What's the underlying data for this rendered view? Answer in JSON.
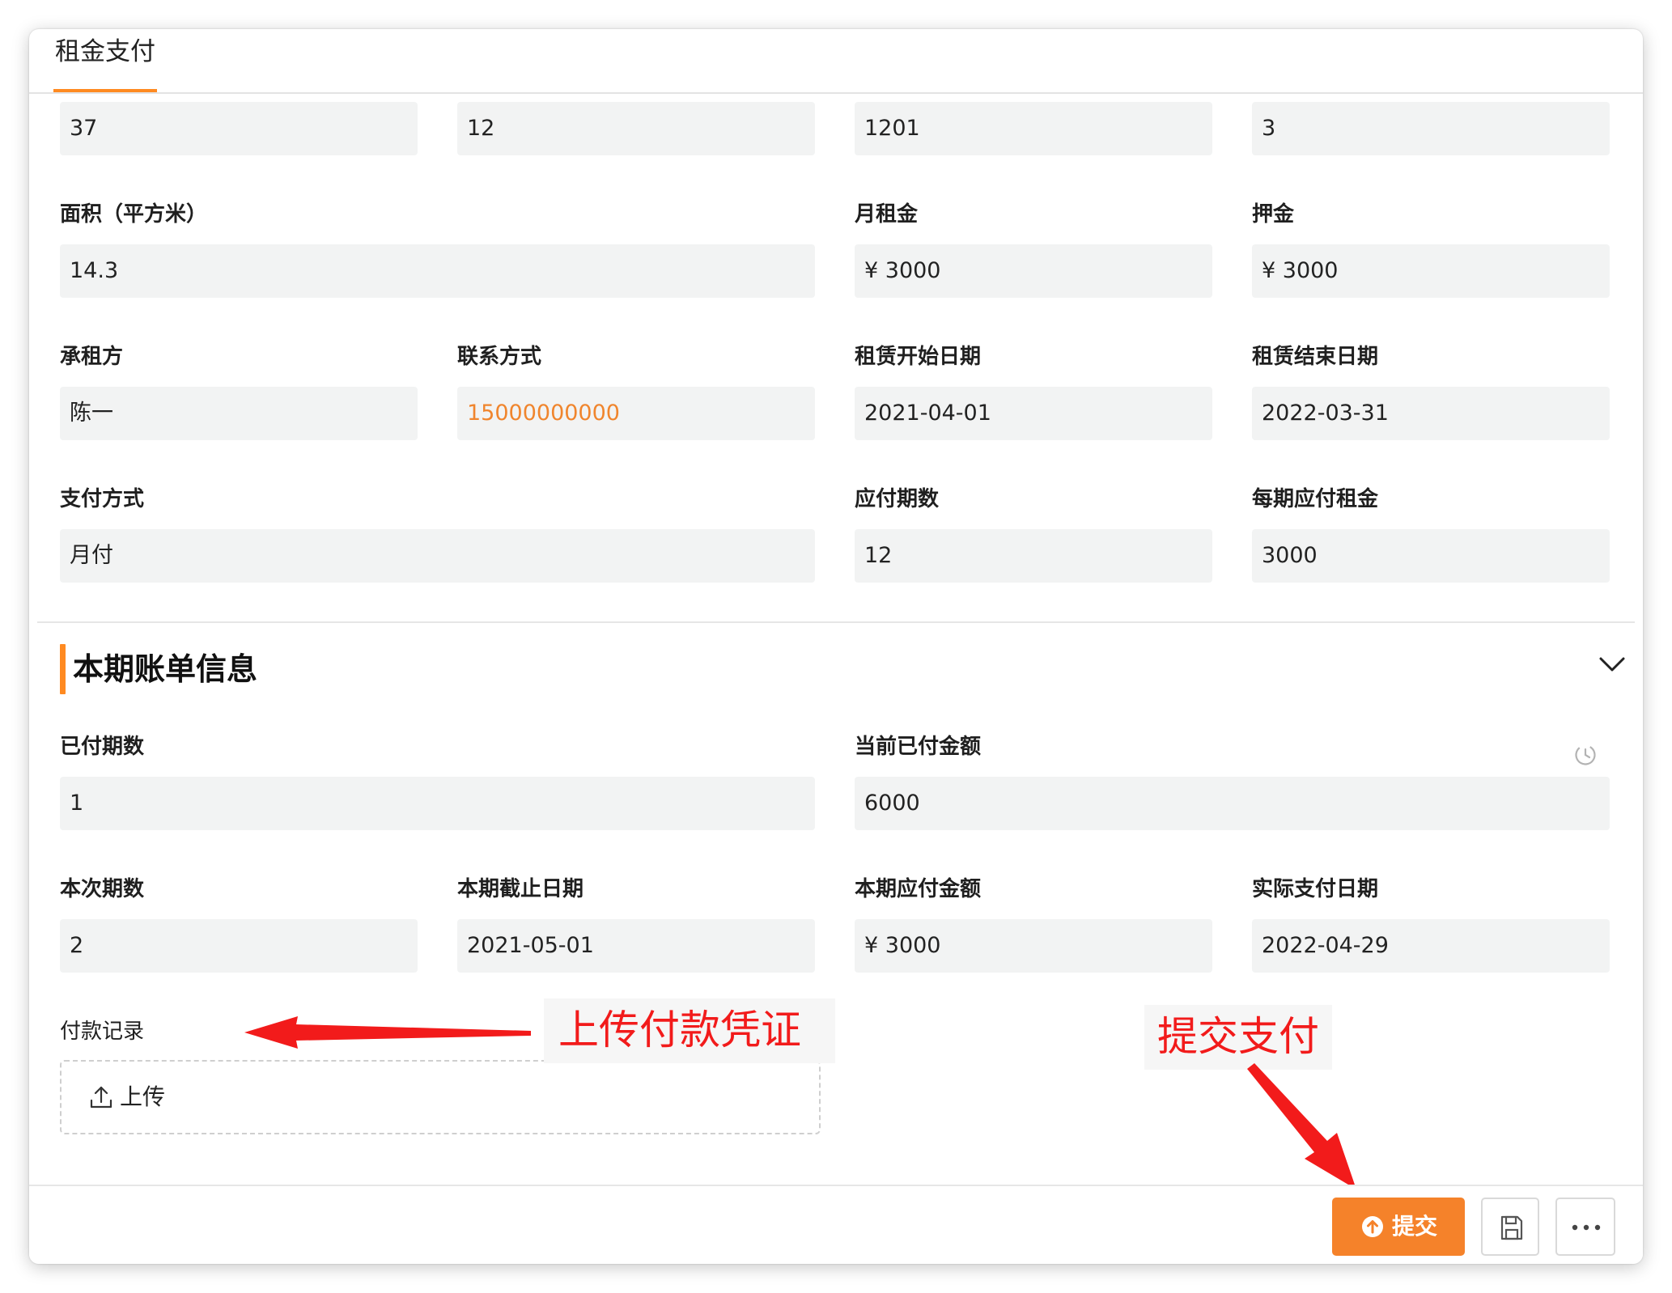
{
  "tabs": [
    {
      "label": "租金支付",
      "active": true
    }
  ],
  "row0": [
    "37",
    "12",
    "1201",
    "3"
  ],
  "fields": {
    "area": {
      "label": "面积（平方米）",
      "value": "14.3"
    },
    "monthly_rent": {
      "label": "月租金",
      "value": "¥ 3000"
    },
    "deposit": {
      "label": "押金",
      "value": "¥ 3000"
    },
    "tenant": {
      "label": "承租方",
      "value": "陈一"
    },
    "contact": {
      "label": "联系方式",
      "value": "15000000000"
    },
    "lease_start": {
      "label": "租赁开始日期",
      "value": "2021-04-01"
    },
    "lease_end": {
      "label": "租赁结束日期",
      "value": "2022-03-31"
    },
    "payment_method": {
      "label": "支付方式",
      "value": "月付"
    },
    "periods_due": {
      "label": "应付期数",
      "value": "12"
    },
    "rent_per_period": {
      "label": "每期应付租金",
      "value": "3000"
    }
  },
  "bill_section": {
    "title": "本期账单信息",
    "paid_periods": {
      "label": "已付期数",
      "value": "1"
    },
    "paid_amount": {
      "label": "当前已付金额",
      "value": "6000"
    },
    "current_period": {
      "label": "本次期数",
      "value": "2"
    },
    "period_deadline": {
      "label": "本期截止日期",
      "value": "2021-05-01"
    },
    "amount_due": {
      "label": "本期应付金额",
      "value": "¥ 3000"
    },
    "actual_pay_date": {
      "label": "实际支付日期",
      "value": "2022-04-29"
    },
    "payment_record": {
      "label": "付款记录",
      "upload_label": "上传"
    }
  },
  "annotations": {
    "upload_hint": "上传付款凭证",
    "submit_hint": "提交支付"
  },
  "toolbar": {
    "submit_label": "提交"
  },
  "colors": {
    "accent": "#f5822a",
    "annotation": "#f21b1b",
    "field_bg": "#f2f3f3"
  }
}
